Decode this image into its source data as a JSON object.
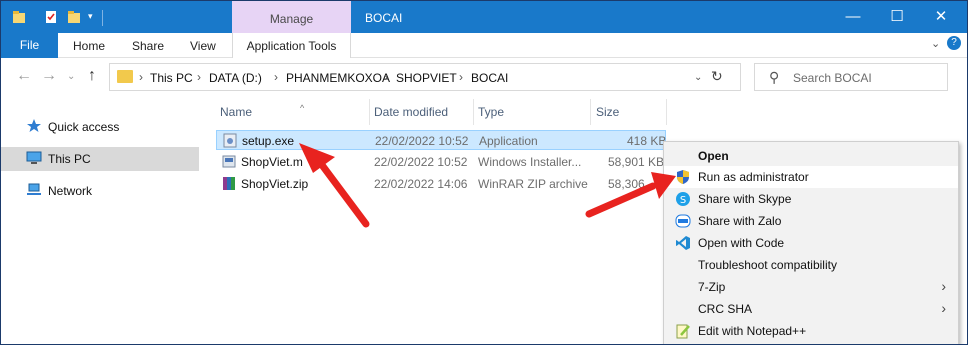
{
  "window": {
    "title": "BOCAI",
    "contextual_tab": "Manage",
    "minimize": "—",
    "maximize": "☐",
    "close": "✕"
  },
  "ribbon": {
    "file": "File",
    "home": "Home",
    "share": "Share",
    "view": "View",
    "application_tools": "Application Tools"
  },
  "address": {
    "crumbs": [
      "This PC",
      "DATA (D:)",
      "PHANMEMKOXOA",
      "SHOPVIET",
      "BOCAI"
    ],
    "separator": "›",
    "search_placeholder": "Search BOCAI"
  },
  "nav": {
    "items": [
      {
        "label": "Quick access",
        "icon": "star-icon"
      },
      {
        "label": "This PC",
        "icon": "computer-icon",
        "selected": true
      },
      {
        "label": "Network",
        "icon": "network-icon"
      }
    ]
  },
  "columns": [
    "Name",
    "Date modified",
    "Type",
    "Size"
  ],
  "files": [
    {
      "name": "setup.exe",
      "date": "22/02/2022 10:52",
      "type": "Application",
      "size": "418 KB",
      "icon": "exe-icon",
      "selected": true
    },
    {
      "name": "ShopViet.m",
      "date": "22/02/2022 10:52",
      "type": "Windows Installer...",
      "size": "58,901 KB",
      "icon": "msi-icon"
    },
    {
      "name": "ShopViet.zip",
      "date": "22/02/2022 14:06",
      "type": "WinRAR ZIP archive",
      "size": "58,306",
      "icon": "zip-icon"
    }
  ],
  "context_menu": [
    {
      "label": "Open",
      "bold": true,
      "icon": ""
    },
    {
      "label": "Run as administrator",
      "icon": "uac-shield-icon",
      "highlighted": true
    },
    {
      "label": "Share with Skype",
      "icon": "skype-icon"
    },
    {
      "label": "Share with Zalo",
      "icon": "zalo-icon"
    },
    {
      "label": "Open with Code",
      "icon": "vscode-icon"
    },
    {
      "label": "Troubleshoot compatibility",
      "icon": ""
    },
    {
      "label": "7-Zip",
      "icon": "",
      "submenu": true
    },
    {
      "label": "CRC SHA",
      "icon": "",
      "submenu": true
    },
    {
      "label": "Edit with Notepad++",
      "icon": "notepadpp-icon"
    }
  ],
  "colors": {
    "titlebar": "#1979ca",
    "manage_tab": "#e7d4f5",
    "selection": "#cce8ff",
    "arrow": "#e8231f"
  }
}
